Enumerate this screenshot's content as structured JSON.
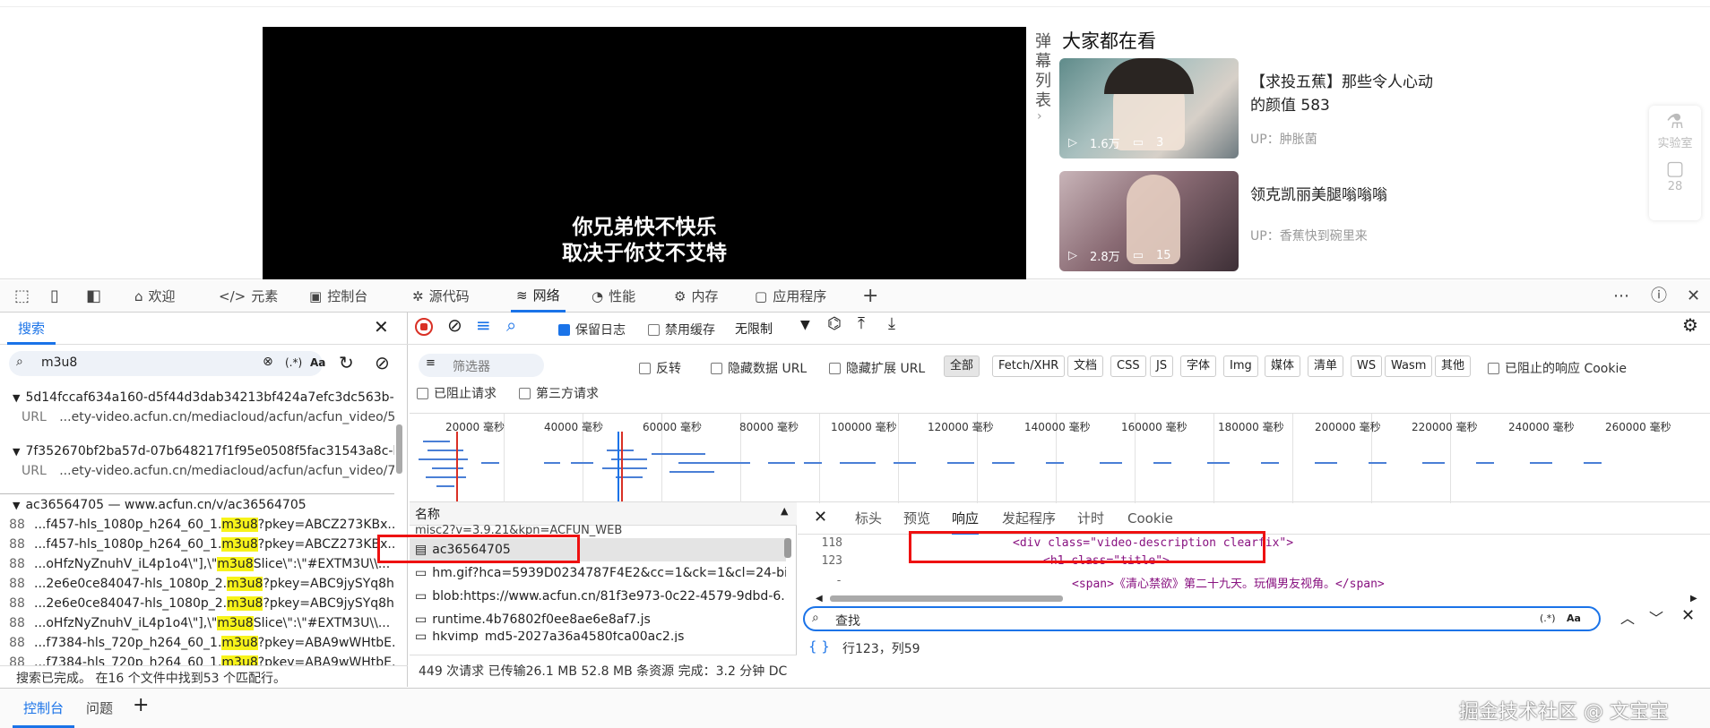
{
  "page": {
    "subtitle_line1": "你兄弟快不快乐",
    "subtitle_line2": "取决于你艾不艾特",
    "danmu_chars": [
      "弹",
      "幕",
      "列",
      "表"
    ],
    "recommend_title": "大家都在看",
    "cards": [
      {
        "title": "【求投五蕉】那些令人心动的颜值 583",
        "views": "1.6万",
        "comments": "3",
        "up": "UP：肿胀菌"
      },
      {
        "title": "领克凯丽美腿嗡嗡嗡",
        "views": "2.8万",
        "comments": "15",
        "up": "UP：香蕉快到碗里来"
      }
    ],
    "side_lab": "实验室",
    "side_count": "28"
  },
  "toolbar": {
    "tabs": [
      "欢迎",
      "元素",
      "控制台",
      "源代码",
      "网络",
      "性能",
      "内存",
      "应用程序"
    ]
  },
  "search_panel": {
    "tab_label": "搜索",
    "query": "m3u8",
    "regex_label": "(.*)",
    "case_label": "Aa",
    "groups": [
      {
        "name": "5d14fccaf634a160-d5f44d3dab34213bf424a7efc3dc563b-...",
        "url_label": "URL",
        "url": "...ety-video.acfun.cn/mediacloud/acfun/acfun_video/5..."
      },
      {
        "name": "7f352670bf2ba57d-07b648217f1f95e0508f5fac31543a8c-h...",
        "url_label": "URL",
        "url": "...ety-video.acfun.cn/mediacloud/acfun/acfun_video/7f..."
      }
    ],
    "file_group": "ac36564705 — www.acfun.cn/v/ac36564705",
    "matches": [
      {
        "line": "88",
        "pre": "...f457-hls_1080p_h264_60_1.",
        "hit": "m3u8",
        "post": "?pkey=ABCZ273KBx..."
      },
      {
        "line": "88",
        "pre": "...f457-hls_1080p_h264_60_1.",
        "hit": "m3u8",
        "post": "?pkey=ABCZ273KBx..."
      },
      {
        "line": "88",
        "pre": "...oHfzNyZnuhV_iL4p1o4\\\"],\\\"",
        "hit": "m3u8",
        "post": "Slice\\\":\\\"#EXTM3U\\\\..."
      },
      {
        "line": "88",
        "pre": "...2e6e0ce84047-hls_1080p_2.",
        "hit": "m3u8",
        "post": "?pkey=ABC9jySYq8h..."
      },
      {
        "line": "88",
        "pre": "...2e6e0ce84047-hls_1080p_2.",
        "hit": "m3u8",
        "post": "?pkey=ABC9jySYq8h..."
      },
      {
        "line": "88",
        "pre": "...oHfzNyZnuhV_iL4p1o4\\\"],\\\"",
        "hit": "m3u8",
        "post": "Slice\\\":\\\"#EXTM3U\\\\..."
      },
      {
        "line": "88",
        "pre": "...f7384-hls_720p_h264_60_1.",
        "hit": "m3u8",
        "post": "?pkey=ABA9wWHtbE..."
      },
      {
        "line": "88",
        "pre": "...f7384-hls_720p_h264_60_1.",
        "hit": "m3u8",
        "post": "?pkey=ABA9wWHtbE..."
      }
    ],
    "status": "搜索已完成。  在16 个文件中找到53 个匹配行。"
  },
  "network": {
    "preserve_log": "保留日志",
    "disable_cache": "禁用缓存",
    "throttle": "无限制",
    "filter_placeholder": "筛选器",
    "invert": "反转",
    "hide_data_url": "隐藏数据 URL",
    "hide_ext_url": "隐藏扩展 URL",
    "types": [
      "全部",
      "Fetch/XHR",
      "文档",
      "CSS",
      "JS",
      "字体",
      "Img",
      "媒体",
      "清单",
      "WS",
      "Wasm",
      "其他"
    ],
    "blocked_cookies": "已阻止的响应 Cookie",
    "blocked_requests": "已阻止请求",
    "third_party": "第三方请求",
    "timeline_ticks": [
      "20000 毫秒",
      "40000 毫秒",
      "60000 毫秒",
      "80000 毫秒",
      "100000 毫秒",
      "120000 毫秒",
      "140000 毫秒",
      "160000 毫秒",
      "180000 毫秒",
      "200000 毫秒",
      "220000 毫秒",
      "240000 毫秒",
      "260000 毫秒"
    ],
    "list_header": "名称",
    "requests": [
      "misc2?v=3.9.21&kpn=ACFUN_WEB",
      "ac36564705",
      "hm.gif?hca=5939D0234787F4E2&cc=1&ck=1&cl=24-bit...",
      "blob:https://www.acfun.cn/81f3e973-0c22-4579-9dbd-6...",
      "runtime.4b76802f0ee8ae6e8af7.js",
      "hkvimp_md5-2027a36a4580fca00ac2.js"
    ],
    "status": "449 次请求  已传输26.1 MB  52.8 MB 条资源  完成：3.2 分钟  DC"
  },
  "detail": {
    "tabs": [
      "标头",
      "预览",
      "响应",
      "发起程序",
      "计时",
      "Cookie"
    ],
    "lines": [
      {
        "no": "118",
        "code": "<div class=\"video-description clearfix\">"
      },
      {
        "no": "123",
        "code": "<h1 class=\"title\">"
      },
      {
        "no": "-",
        "code": "<span>《清心禁欲》第二十九天。玩偶男友视角。</span>"
      }
    ],
    "find_placeholder": "查找",
    "position": "行123，列59",
    "braces": "{ }"
  },
  "drawer": {
    "tabs": [
      "控制台",
      "问题"
    ],
    "watermark": "掘金技术社区 @ 文宝宝"
  },
  "colors": {
    "accent": "#1a73e8",
    "highlight": "#f7f31a",
    "annotation": "#e11111"
  }
}
